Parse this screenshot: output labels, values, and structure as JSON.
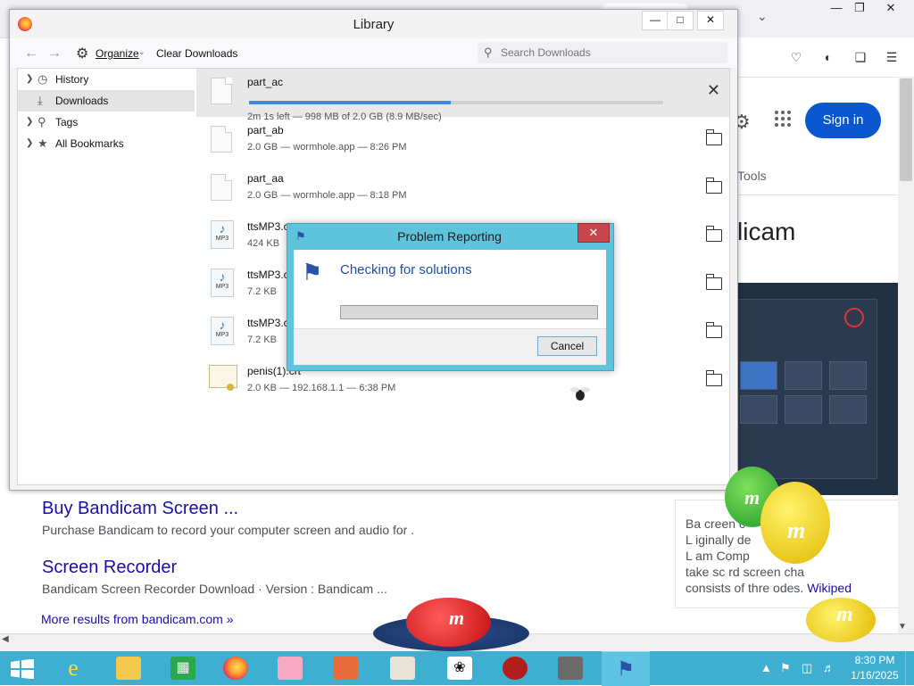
{
  "browser": {
    "signin_label": "Sign in",
    "tools_label": "Tools",
    "side_title": "licam",
    "snippet": {
      "lines": [
        "Ba            creen c",
        "L    iginally de",
        "L           am Comp",
        "take sc       rd screen cha"
      ],
      "last_line_prefix": "consists of thre     odes. ",
      "last_line_link": "Wikiped"
    },
    "results": [
      {
        "title": "Buy Bandicam Screen ...",
        "desc": "Purchase Bandicam to record your computer screen and audio for ."
      },
      {
        "title": "Screen Recorder",
        "desc": "Bandicam Screen Recorder Download · Version : Bandicam ..."
      }
    ],
    "more_results": "More results from bandicam.com »"
  },
  "library": {
    "title": "Library",
    "toolbar": {
      "organize_label": "Organize",
      "clear_downloads_label": "Clear Downloads",
      "search_placeholder": "Search Downloads"
    },
    "sidebar": [
      {
        "label": "History",
        "icon": "clock-icon",
        "expandable": true
      },
      {
        "label": "Downloads",
        "icon": "download-icon",
        "expandable": false,
        "selected": true
      },
      {
        "label": "Tags",
        "icon": "tag-icon",
        "expandable": true
      },
      {
        "label": "All Bookmarks",
        "icon": "star-icon",
        "expandable": true
      }
    ],
    "downloads": [
      {
        "name": "part_ac",
        "status": "2m 1s left — 998 MB of 2.0 GB (8.9 MB/sec)",
        "progress_fraction": 0.487,
        "type": "file",
        "active": true
      },
      {
        "name": "part_ab",
        "status": "2.0 GB — wormhole.app — 8:26 PM",
        "type": "file"
      },
      {
        "name": "part_aa",
        "status": "2.0 GB — wormhole.app — 8:18 PM",
        "type": "file"
      },
      {
        "name": "ttsMP3.c",
        "status": "424 KB",
        "type": "mp3"
      },
      {
        "name": "ttsMP3.c",
        "status": "7.2 KB",
        "type": "mp3"
      },
      {
        "name": "ttsMP3.c",
        "status": "7.2 KB",
        "type": "mp3"
      },
      {
        "name": "penis(1).crt",
        "status": "2.0 KB — 192.168.1.1 — 6:38 PM",
        "type": "certificate"
      }
    ]
  },
  "dialog": {
    "title": "Problem Reporting",
    "message": "Checking for solutions",
    "cancel_label": "Cancel"
  },
  "taskbar": {
    "clock_time": "8:30 PM",
    "clock_date": "1/16/2025",
    "accent": "#3eaed1"
  }
}
